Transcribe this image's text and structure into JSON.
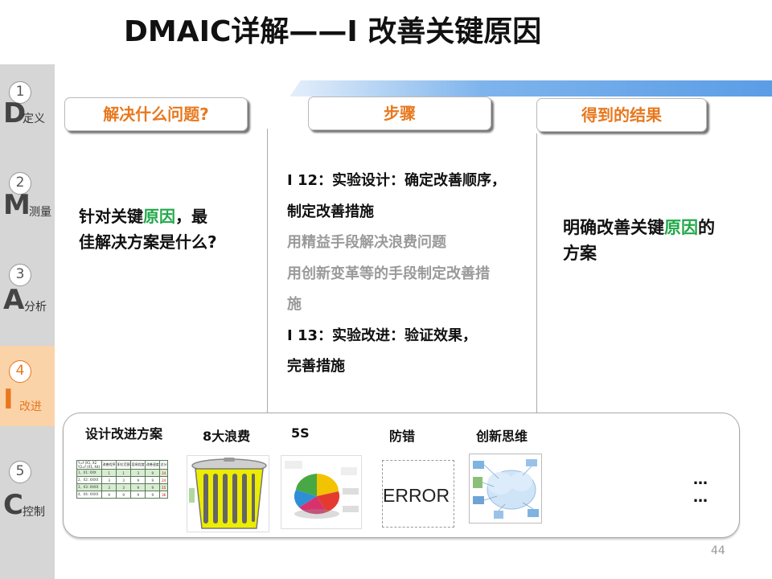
{
  "title": "DMAIC详解——I 改善关键原因",
  "sidebar": {
    "steps": [
      {
        "num": "1",
        "letter": "D",
        "name": "定义",
        "active": false
      },
      {
        "num": "2",
        "letter": "M",
        "name": "测量",
        "active": false
      },
      {
        "num": "3",
        "letter": "A",
        "name": "分析",
        "active": false
      },
      {
        "num": "4",
        "letter": "I",
        "name": "改进",
        "active": true
      },
      {
        "num": "5",
        "letter": "C",
        "name": "控制",
        "active": false
      }
    ]
  },
  "headers": {
    "problem": "解决什么问题?",
    "steps": "步骤",
    "result": "得到的结果"
  },
  "problem": {
    "part1": "针对关键",
    "highlight": "原因",
    "part2": "，最",
    "part3": "佳解决方案是什么?"
  },
  "steps_list": {
    "l1": "I 12：实验设计：确定改善顺序，",
    "l2": "制定改善措施",
    "l3": "用精益手段解决浪费问题",
    "l4": "用创新变革等的手段制定改善措",
    "l5": "施",
    "l6": " I 13：实验改进：验证效果，",
    "l7": "完善措施"
  },
  "result": {
    "part1": "明确改善关键",
    "highlight": "原因",
    "part2": "的",
    "part3": "方案"
  },
  "tools": {
    "labels": [
      "设计改进方案",
      "8大浪费",
      "5S",
      "防错",
      "创新思维"
    ],
    "error_word": "ERROR",
    "ellipsis1": "…",
    "ellipsis2": "…",
    "table": {
      "head1": "Y=f (X1, X2",
      "head2": "Y2=f (X1, X4)",
      "cols": [
        "改善程序",
        "职位范围",
        "容易程度",
        "改善速度",
        "总分"
      ],
      "rows": [
        [
          "1、X1: XXX",
          "1",
          "1",
          "3",
          "9",
          "14"
        ],
        [
          "2、X2: XXXX",
          "3",
          "3",
          "9",
          "9",
          "24"
        ],
        [
          "3、X3: XXXX",
          "3",
          "3",
          "9",
          "9",
          "15"
        ],
        [
          "4、X4: XXXX",
          "9",
          "9",
          "9",
          "9",
          "36"
        ]
      ]
    }
  },
  "page_number": "44",
  "colors": {
    "accent_orange": "#e8781e",
    "highlight_green": "#22a84a",
    "sidebar_gray": "#d6d6d6",
    "active_step_bg": "#fbd3a9"
  }
}
